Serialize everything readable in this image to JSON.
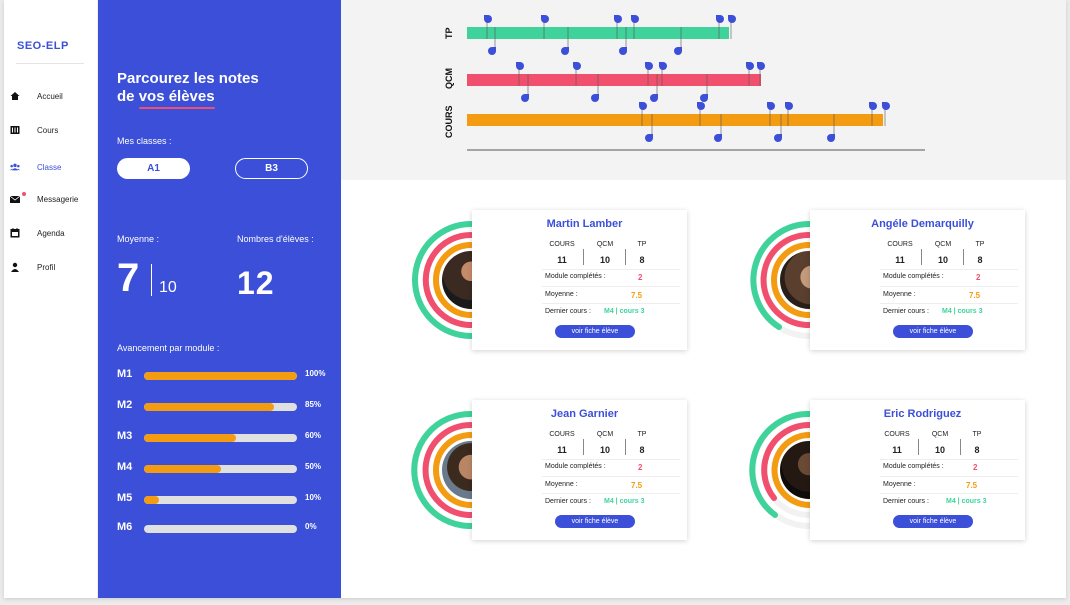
{
  "brand": "SEO-ELP",
  "nav": [
    {
      "label": "Accueil",
      "icon": "home-icon"
    },
    {
      "label": "Cours",
      "icon": "book-icon"
    },
    {
      "label": "Classe",
      "icon": "people-icon"
    },
    {
      "label": "Messagerie",
      "icon": "mail-icon"
    },
    {
      "label": "Agenda",
      "icon": "calendar-icon"
    },
    {
      "label": "Profil",
      "icon": "user-icon"
    }
  ],
  "panel": {
    "title_line1": "Parcourez les notes",
    "title_prefix": "de ",
    "title_underlined": "vos élèves",
    "classes_label": "Mes classes :",
    "class_a": "A1",
    "class_b": "B3",
    "moyenne_label": "Moyenne :",
    "moyenne_value": "7",
    "moyenne_den": "10",
    "nb_label": "Nombres d'élèves :",
    "nb_value": "12",
    "avancement_label": "Avancement par module :",
    "modules": [
      {
        "name": "M1",
        "pct": "100%",
        "value": 100
      },
      {
        "name": "M2",
        "pct": "85%",
        "value": 85
      },
      {
        "name": "M3",
        "pct": "60%",
        "value": 60
      },
      {
        "name": "M4",
        "pct": "50%",
        "value": 50
      },
      {
        "name": "M5",
        "pct": "10%",
        "value": 10
      },
      {
        "name": "M6",
        "pct": "0%",
        "value": 0
      }
    ]
  },
  "timeline": {
    "rows": [
      {
        "label": "TP",
        "color": "#3fd39b"
      },
      {
        "label": "QCM",
        "color": "#f0506e"
      },
      {
        "label": "COURS",
        "color": "#f39c12"
      }
    ]
  },
  "students": [
    {
      "name": "Martin Lamber",
      "cours": "11",
      "qcm": "10",
      "tp": "8",
      "modules": "2",
      "moyenne": "7.5",
      "dernier": "M4 | cours 3"
    },
    {
      "name": "Angéle Demarquilly",
      "cours": "11",
      "qcm": "10",
      "tp": "8",
      "modules": "2",
      "moyenne": "7.5",
      "dernier": "M4 | cours 3"
    },
    {
      "name": "Jean Garnier",
      "cours": "11",
      "qcm": "10",
      "tp": "8",
      "modules": "2",
      "moyenne": "7.5",
      "dernier": "M4 | cours 3"
    },
    {
      "name": "Eric Rodriguez",
      "cours": "11",
      "qcm": "10",
      "tp": "8",
      "modules": "2",
      "moyenne": "7.5",
      "dernier": "M4 | cours 3"
    }
  ],
  "card_labels": {
    "cours": "COURS",
    "qcm": "QCM",
    "tp": "TP",
    "modules": "Module complétés :",
    "moyenne": "Moyenne :",
    "dernier": "Dernier cours :",
    "fiche": "voir fiche élève"
  },
  "colors": {
    "accent": "#3b4fd8",
    "green": "#3fd39b",
    "pink": "#f0506e",
    "orange": "#f39c12"
  }
}
